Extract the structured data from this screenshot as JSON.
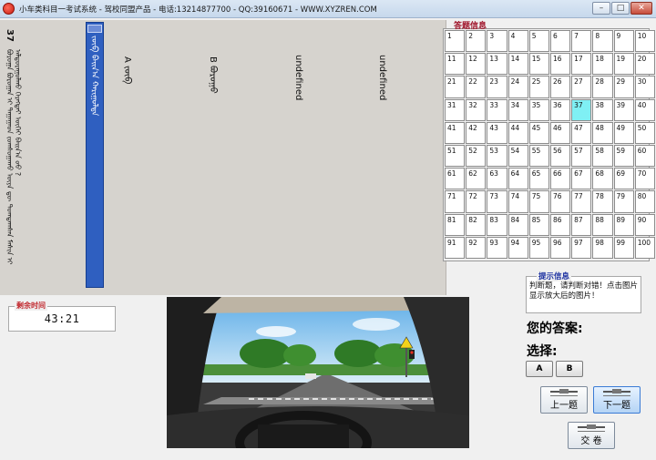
{
  "window": {
    "title": "小车类科目一考试系统 - 驾校同盟产品 - 电话:13214877700 - QQ:39160671 - WWW.XYZREN.COM",
    "min": "–",
    "max": "□",
    "close": "✕",
    "app_icon": "app-logo-icon"
  },
  "question": {
    "number": "37",
    "text": "ᠪᠣᠷᠣᠭᠠ ᠪᠣᠷᠤᠭᠠᠨ ᠢ ᠳᠠᠭᠠᠭᠠᠳ ᠵᠣᠭᠰᠤᠭᠠᠬᠤ ᠦᠶᠡ ᠳᠦ ᠳᠤᠭᠳᠠᠭᠰᠠᠨ ᠮᠠᠰᠢᠨ ᠢ ᠠᠯᠳᠤᠷᠠᠭᠤᠯᠬᠤ ᠬᠡᠷᠡᠭᠲᠡᠢ ᠦᠭᠡᠢ ᠪᠠᠢᠨ᠎ᠠ ᠤᠤ ?",
    "selected_option": "ᠵᠥᠪ ᠪᠠᠢᠨ᠎ᠠ ᠬᠠᠷᠢᠭᠤᠯᠲᠠ",
    "options": [
      "A ᠵᠥᠪ",
      "B ᠪᠤᠷᠤᠭᠤ",
      "undefined",
      "undefined"
    ]
  },
  "answer_info": {
    "title": "答题信息",
    "current": 37,
    "cells": [
      "1",
      "2",
      "3",
      "4",
      "5",
      "6",
      "7",
      "8",
      "9",
      "10",
      "11",
      "12",
      "13",
      "14",
      "15",
      "16",
      "17",
      "18",
      "19",
      "20",
      "21",
      "22",
      "23",
      "24",
      "25",
      "26",
      "27",
      "28",
      "29",
      "30",
      "31",
      "32",
      "33",
      "34",
      "35",
      "36",
      "37",
      "38",
      "39",
      "40",
      "41",
      "42",
      "43",
      "44",
      "45",
      "46",
      "47",
      "48",
      "49",
      "50",
      "51",
      "52",
      "53",
      "54",
      "55",
      "56",
      "57",
      "58",
      "59",
      "60",
      "61",
      "62",
      "63",
      "64",
      "65",
      "66",
      "67",
      "68",
      "69",
      "70",
      "71",
      "72",
      "73",
      "74",
      "75",
      "76",
      "77",
      "78",
      "79",
      "80",
      "81",
      "82",
      "83",
      "84",
      "85",
      "86",
      "87",
      "88",
      "89",
      "90",
      "91",
      "92",
      "93",
      "94",
      "95",
      "96",
      "97",
      "98",
      "99",
      "100"
    ]
  },
  "timer": {
    "label": "剩余时间",
    "value": "43:21"
  },
  "hint": {
    "title": "提示信息",
    "text": "判断题，请判断对错！点击图片显示放大后的图片！"
  },
  "answer_area": {
    "your_answer": "您的答案:",
    "choose": "选择:",
    "option_a": "A",
    "option_b": "B"
  },
  "nav": {
    "prev": "上一题",
    "next": "下一题",
    "submit": "交 卷",
    "prev_icon": "prev-icon",
    "next_icon": "next-icon",
    "submit_icon": "submit-icon"
  },
  "colors": {
    "current_cell": "#7ff0f4",
    "selected_option": "#2f5fc0",
    "timer_label": "#c1272d",
    "hint_title": "#1a2fa0",
    "answer_title": "#a0152b"
  }
}
